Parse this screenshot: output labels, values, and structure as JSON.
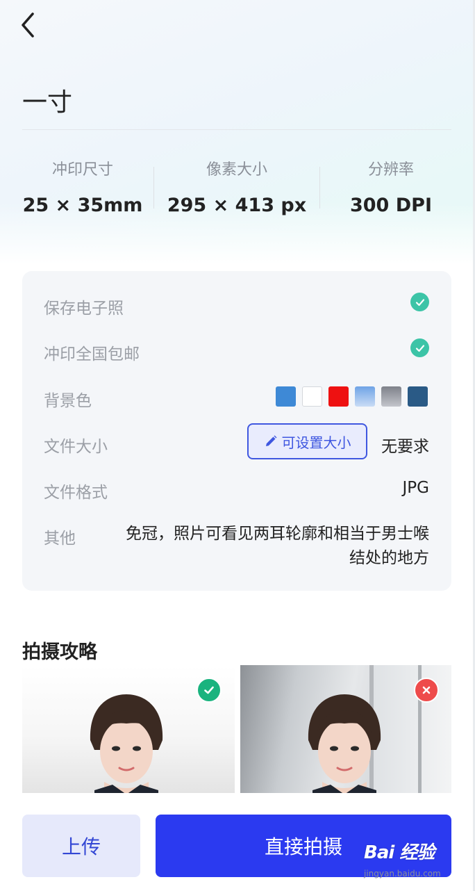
{
  "header": {
    "title": "一寸"
  },
  "specs": [
    {
      "label": "冲印尺寸",
      "value": "25 × 35mm"
    },
    {
      "label": "像素大小",
      "value": "295 × 413 px"
    },
    {
      "label": "分辨率",
      "value": "300 DPI"
    }
  ],
  "info": {
    "save_label": "保存电子照",
    "print_label": "冲印全国包邮",
    "bg_label": "背景色",
    "bg_colors": [
      "#3e89d6",
      "#ffffff",
      "#ee1111",
      "#8fb8ea",
      "#8d8f98",
      "#2a5a86"
    ],
    "filesize_label": "文件大小",
    "filesize_button": "可设置大小",
    "filesize_value": "无要求",
    "format_label": "文件格式",
    "format_value": "JPG",
    "other_label": "其他",
    "other_value": "免冠，照片可看见两耳轮廓和相当于男士喉结处的地方"
  },
  "guide": {
    "title": "拍摄攻略"
  },
  "actions": {
    "upload": "上传",
    "shoot": "直接拍摄"
  },
  "watermark": {
    "logo": "Bai 经验",
    "url": "jingyan.baidu.com"
  },
  "colors": {
    "accent": "#2b3af0",
    "check": "#3cc4a7",
    "ok": "#1ab37e",
    "no": "#ee4b4b"
  }
}
